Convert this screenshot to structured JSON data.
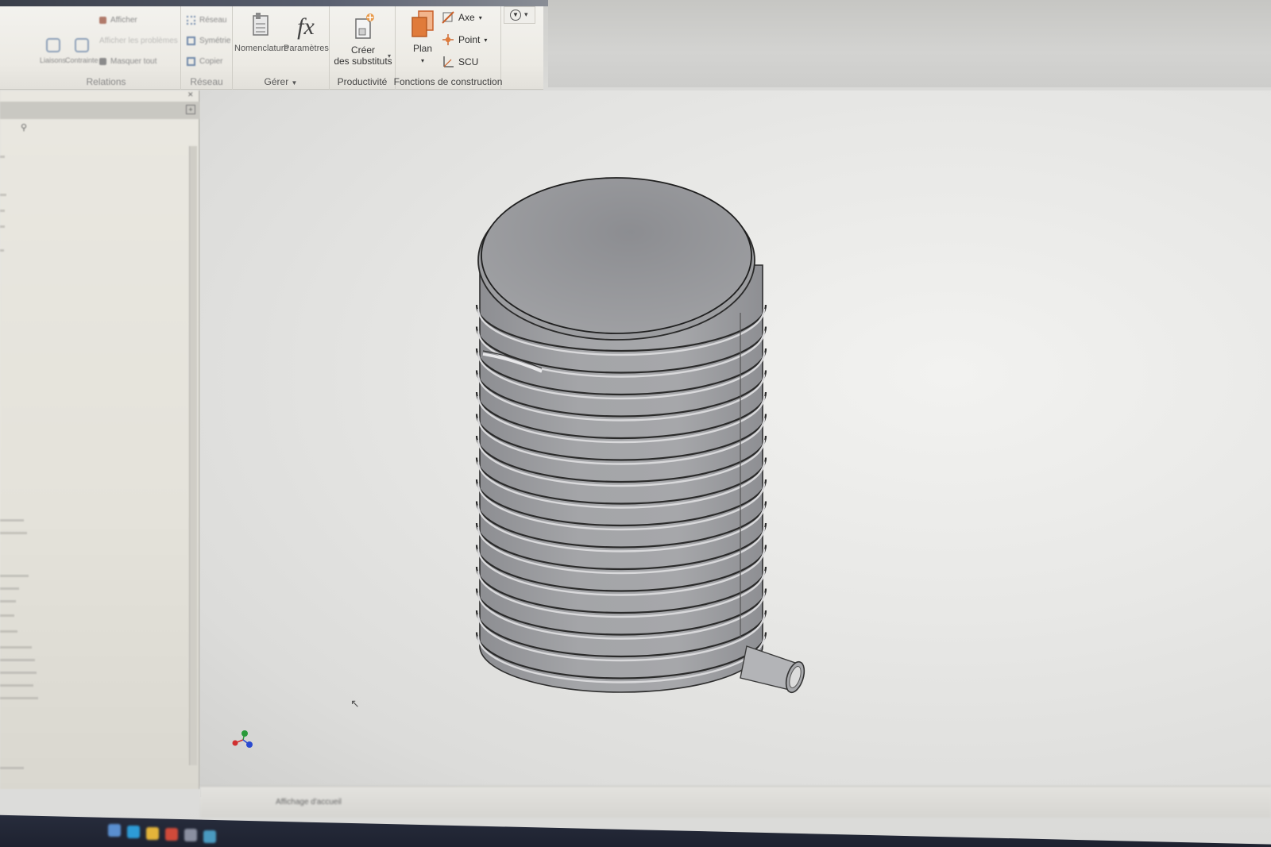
{
  "ribbon": {
    "panels": {
      "relations": {
        "label": "Relations",
        "items": [
          "Afficher",
          "Afficher les problèmes",
          "Masquer tout",
          "Liaisons",
          "Contrainte"
        ]
      },
      "reseau": {
        "label": "Réseau",
        "items": [
          "Réseau",
          "Symétrie",
          "Copier"
        ]
      },
      "gerer": {
        "label": "Gérer",
        "nomenclature": "Nomenclature",
        "parametres": "Paramètres",
        "fx_symbol": "fx"
      },
      "productivite": {
        "label": "Productivité",
        "creer_line1": "Créer",
        "creer_line2": "des substituts"
      },
      "construction": {
        "label": "Fonctions de construction",
        "plan": "Plan",
        "axe": "Axe",
        "point": "Point",
        "scu": "SCU"
      }
    }
  },
  "statusbar": {
    "text": "Affichage d'accueil"
  },
  "colors": {
    "ribbon_bg": "#eceae4",
    "model_body": "#9a9b9e",
    "model_top": "#8e8f93",
    "accent_orange": "#e07b3a",
    "taskbar": "#1e2230"
  },
  "icons": [
    "nomenclature-icon",
    "fx-icon",
    "create-substitute-icon",
    "plan-icon",
    "axis-icon",
    "point-icon",
    "ucs-icon",
    "view-cube-orientation-icon",
    "quick-access-dropdown-icon"
  ]
}
